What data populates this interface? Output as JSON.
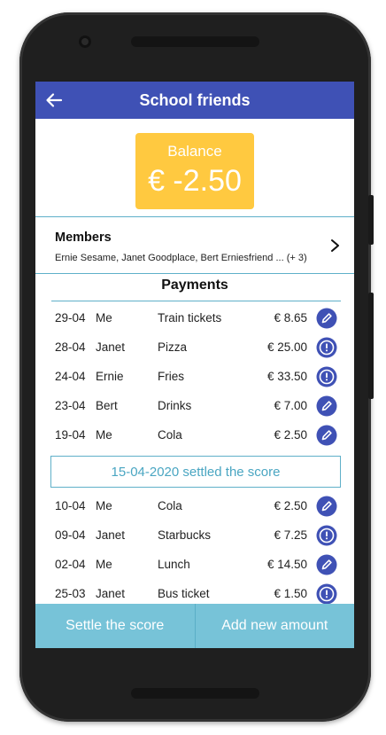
{
  "header": {
    "title": "School friends"
  },
  "balance": {
    "label": "Balance",
    "value": "€ -2.50"
  },
  "members": {
    "title": "Members",
    "names": "Ernie Sesame, Janet Goodplace, Bert Erniesfriend ... (+ 3)"
  },
  "payments": {
    "title": "Payments",
    "rows": [
      {
        "date": "29-04",
        "who": "Me",
        "what": "Train tickets",
        "amount": "€ 8.65",
        "icon": "edit-icon"
      },
      {
        "date": "28-04",
        "who": "Janet",
        "what": "Pizza",
        "amount": "€ 25.00",
        "icon": "info-icon"
      },
      {
        "date": "24-04",
        "who": "Ernie",
        "what": "Fries",
        "amount": "€ 33.50",
        "icon": "info-icon"
      },
      {
        "date": "23-04",
        "who": "Bert",
        "what": "Drinks",
        "amount": "€ 7.00",
        "icon": "edit-icon"
      },
      {
        "date": "19-04",
        "who": "Me",
        "what": "Cola",
        "amount": "€ 2.50",
        "icon": "edit-icon"
      },
      {
        "date": "10-04",
        "who": "Me",
        "what": "Cola",
        "amount": "€ 2.50",
        "icon": "edit-icon"
      },
      {
        "date": "09-04",
        "who": "Janet",
        "what": "Starbucks",
        "amount": "€ 7.25",
        "icon": "info-icon"
      },
      {
        "date": "02-04",
        "who": "Me",
        "what": "Lunch",
        "amount": "€ 14.50",
        "icon": "edit-icon"
      },
      {
        "date": "25-03",
        "who": "Janet",
        "what": "Bus ticket",
        "amount": "€ 1.50",
        "icon": "info-icon"
      }
    ],
    "settled": "15-04-2020  settled the score"
  },
  "actions": {
    "settle": "Settle the score",
    "add": "Add new amount"
  },
  "colors": {
    "appbar": "#3f51b5",
    "balance": "#ffc940",
    "accent": "#77c3d8",
    "icon": "#3f51b5"
  }
}
